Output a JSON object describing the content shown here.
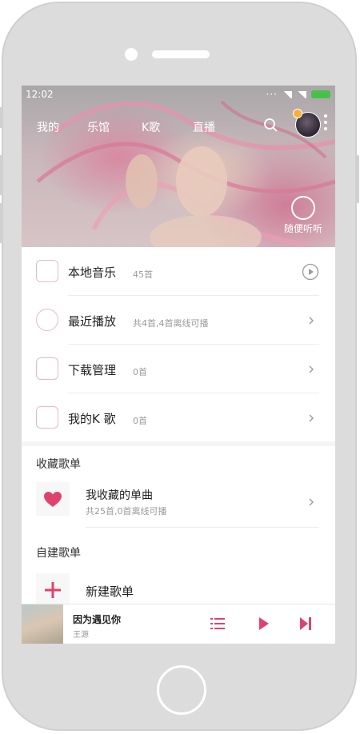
{
  "status": {
    "time": "12:02"
  },
  "topnav": {
    "tabs": [
      {
        "label": "我的"
      },
      {
        "label": "乐馆"
      },
      {
        "label": "K歌"
      },
      {
        "label": "直播"
      }
    ]
  },
  "hero": {
    "badge_label": "随便听听"
  },
  "library": {
    "items": [
      {
        "title": "本地音乐",
        "count": "45首",
        "action": "play"
      },
      {
        "title": "最近播放",
        "count": "共4首,4首离线可播",
        "action": "chevron"
      },
      {
        "title": "下载管理",
        "count": "0首",
        "action": "chevron"
      },
      {
        "title": "我的K 歌",
        "count": "0首",
        "action": "chevron"
      }
    ]
  },
  "favorites": {
    "section_title": "收藏歌单",
    "item_title": "我收藏的单曲",
    "item_subtitle": "共25首,0首离线可播"
  },
  "custom": {
    "section_title": "自建歌单",
    "new_label": "新建歌单"
  },
  "player": {
    "song": "因为遇见你",
    "artist": "王源"
  },
  "colors": {
    "accent": "#e0426e",
    "battery": "#47c14a",
    "icon_border": "#e9b9c6"
  }
}
